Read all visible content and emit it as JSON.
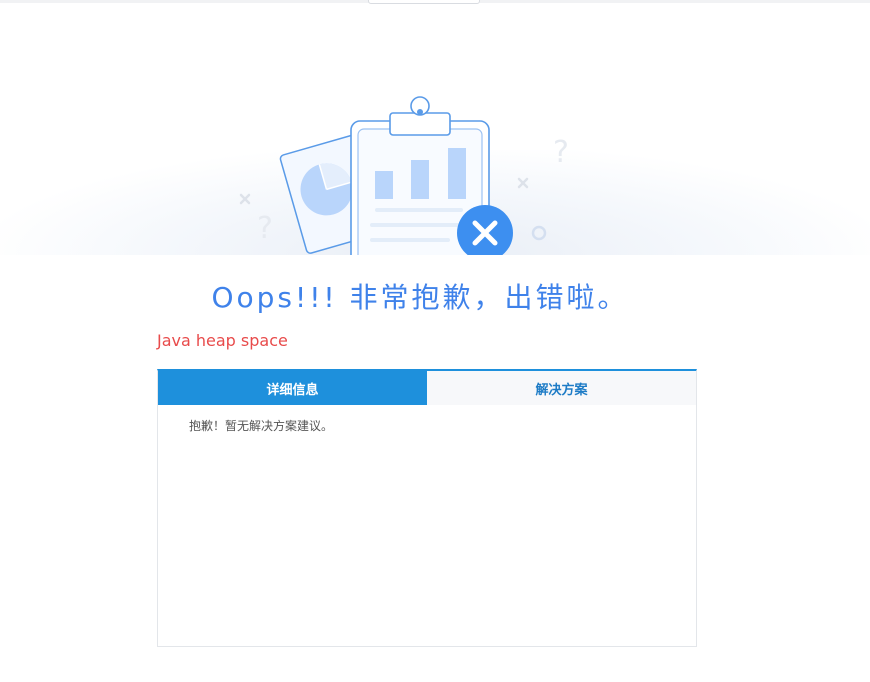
{
  "headline": "Oops!!! 非常抱歉，出错啦。",
  "error_message": "Java heap space",
  "tabs": [
    {
      "label": "详细信息",
      "active": true
    },
    {
      "label": "解决方案",
      "active": false
    }
  ],
  "tab_content": "抱歉！暂无解决方案建议。",
  "illustration": {
    "icon_names": [
      "clipboard-icon",
      "pie-chart-card-icon",
      "error-x-icon",
      "question-mark-icon",
      "cross-mark-icon",
      "circle-dot-icon"
    ],
    "question_mark_glyph": "?"
  },
  "colors": {
    "headline": "#3f82ea",
    "error_text": "#e84b4b",
    "tab_active_bg": "#1e90dc",
    "tab_inactive_text": "#1e7cc6",
    "illustration_stroke": "#5a9be8",
    "illustration_fill": "#b9d5fb",
    "error_badge": "#3d8ff0"
  }
}
